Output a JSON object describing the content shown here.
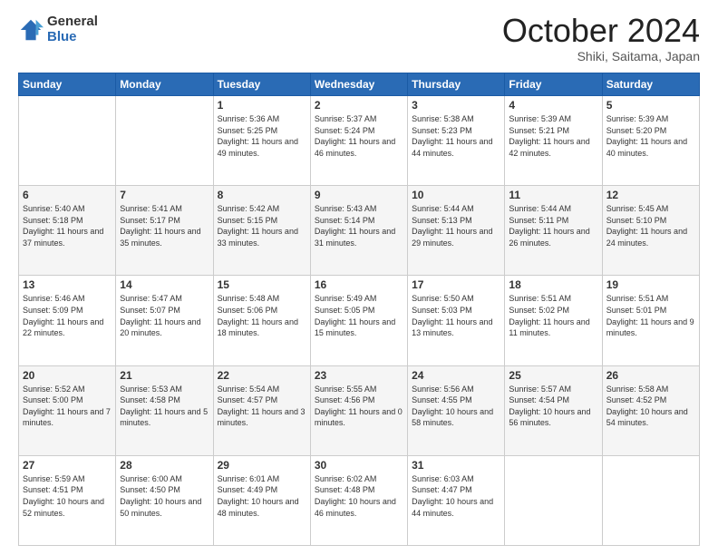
{
  "logo": {
    "general": "General",
    "blue": "Blue"
  },
  "title": "October 2024",
  "subtitle": "Shiki, Saitama, Japan",
  "days_of_week": [
    "Sunday",
    "Monday",
    "Tuesday",
    "Wednesday",
    "Thursday",
    "Friday",
    "Saturday"
  ],
  "weeks": [
    [
      {
        "day": "",
        "info": ""
      },
      {
        "day": "",
        "info": ""
      },
      {
        "day": "1",
        "sunrise": "5:36 AM",
        "sunset": "5:25 PM",
        "daylight": "11 hours and 49 minutes."
      },
      {
        "day": "2",
        "sunrise": "5:37 AM",
        "sunset": "5:24 PM",
        "daylight": "11 hours and 46 minutes."
      },
      {
        "day": "3",
        "sunrise": "5:38 AM",
        "sunset": "5:23 PM",
        "daylight": "11 hours and 44 minutes."
      },
      {
        "day": "4",
        "sunrise": "5:39 AM",
        "sunset": "5:21 PM",
        "daylight": "11 hours and 42 minutes."
      },
      {
        "day": "5",
        "sunrise": "5:39 AM",
        "sunset": "5:20 PM",
        "daylight": "11 hours and 40 minutes."
      }
    ],
    [
      {
        "day": "6",
        "sunrise": "5:40 AM",
        "sunset": "5:18 PM",
        "daylight": "11 hours and 37 minutes."
      },
      {
        "day": "7",
        "sunrise": "5:41 AM",
        "sunset": "5:17 PM",
        "daylight": "11 hours and 35 minutes."
      },
      {
        "day": "8",
        "sunrise": "5:42 AM",
        "sunset": "5:15 PM",
        "daylight": "11 hours and 33 minutes."
      },
      {
        "day": "9",
        "sunrise": "5:43 AM",
        "sunset": "5:14 PM",
        "daylight": "11 hours and 31 minutes."
      },
      {
        "day": "10",
        "sunrise": "5:44 AM",
        "sunset": "5:13 PM",
        "daylight": "11 hours and 29 minutes."
      },
      {
        "day": "11",
        "sunrise": "5:44 AM",
        "sunset": "5:11 PM",
        "daylight": "11 hours and 26 minutes."
      },
      {
        "day": "12",
        "sunrise": "5:45 AM",
        "sunset": "5:10 PM",
        "daylight": "11 hours and 24 minutes."
      }
    ],
    [
      {
        "day": "13",
        "sunrise": "5:46 AM",
        "sunset": "5:09 PM",
        "daylight": "11 hours and 22 minutes."
      },
      {
        "day": "14",
        "sunrise": "5:47 AM",
        "sunset": "5:07 PM",
        "daylight": "11 hours and 20 minutes."
      },
      {
        "day": "15",
        "sunrise": "5:48 AM",
        "sunset": "5:06 PM",
        "daylight": "11 hours and 18 minutes."
      },
      {
        "day": "16",
        "sunrise": "5:49 AM",
        "sunset": "5:05 PM",
        "daylight": "11 hours and 15 minutes."
      },
      {
        "day": "17",
        "sunrise": "5:50 AM",
        "sunset": "5:03 PM",
        "daylight": "11 hours and 13 minutes."
      },
      {
        "day": "18",
        "sunrise": "5:51 AM",
        "sunset": "5:02 PM",
        "daylight": "11 hours and 11 minutes."
      },
      {
        "day": "19",
        "sunrise": "5:51 AM",
        "sunset": "5:01 PM",
        "daylight": "11 hours and 9 minutes."
      }
    ],
    [
      {
        "day": "20",
        "sunrise": "5:52 AM",
        "sunset": "5:00 PM",
        "daylight": "11 hours and 7 minutes."
      },
      {
        "day": "21",
        "sunrise": "5:53 AM",
        "sunset": "4:58 PM",
        "daylight": "11 hours and 5 minutes."
      },
      {
        "day": "22",
        "sunrise": "5:54 AM",
        "sunset": "4:57 PM",
        "daylight": "11 hours and 3 minutes."
      },
      {
        "day": "23",
        "sunrise": "5:55 AM",
        "sunset": "4:56 PM",
        "daylight": "11 hours and 0 minutes."
      },
      {
        "day": "24",
        "sunrise": "5:56 AM",
        "sunset": "4:55 PM",
        "daylight": "10 hours and 58 minutes."
      },
      {
        "day": "25",
        "sunrise": "5:57 AM",
        "sunset": "4:54 PM",
        "daylight": "10 hours and 56 minutes."
      },
      {
        "day": "26",
        "sunrise": "5:58 AM",
        "sunset": "4:52 PM",
        "daylight": "10 hours and 54 minutes."
      }
    ],
    [
      {
        "day": "27",
        "sunrise": "5:59 AM",
        "sunset": "4:51 PM",
        "daylight": "10 hours and 52 minutes."
      },
      {
        "day": "28",
        "sunrise": "6:00 AM",
        "sunset": "4:50 PM",
        "daylight": "10 hours and 50 minutes."
      },
      {
        "day": "29",
        "sunrise": "6:01 AM",
        "sunset": "4:49 PM",
        "daylight": "10 hours and 48 minutes."
      },
      {
        "day": "30",
        "sunrise": "6:02 AM",
        "sunset": "4:48 PM",
        "daylight": "10 hours and 46 minutes."
      },
      {
        "day": "31",
        "sunrise": "6:03 AM",
        "sunset": "4:47 PM",
        "daylight": "10 hours and 44 minutes."
      },
      {
        "day": "",
        "info": ""
      },
      {
        "day": "",
        "info": ""
      }
    ]
  ]
}
